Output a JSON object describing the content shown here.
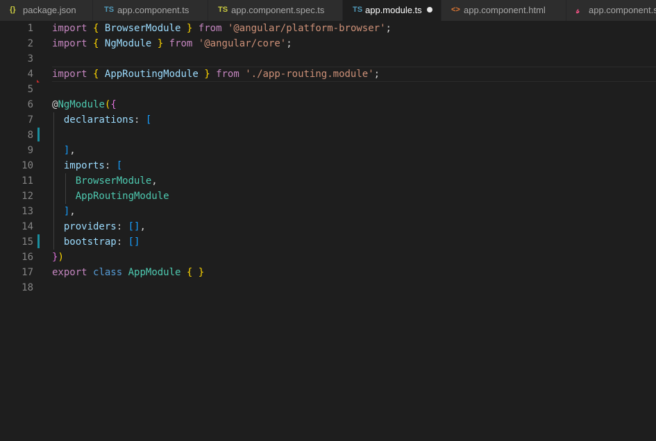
{
  "tabs": [
    {
      "icon": "{}",
      "icon_color": "#cbcb41",
      "label": "package.json",
      "active": false
    },
    {
      "icon": "TS",
      "icon_color": "#519aba",
      "label": "app.component.ts",
      "active": false
    },
    {
      "icon": "TS",
      "icon_color": "#cbcb41",
      "label": "app.component.spec.ts",
      "active": false
    },
    {
      "icon": "TS",
      "icon_color": "#519aba",
      "label": "app.module.ts",
      "active": true,
      "modified": true
    },
    {
      "icon": "<>",
      "icon_color": "#e37933",
      "label": "app.component.html",
      "active": false
    },
    {
      "icon": "scss",
      "icon_color": "#f55385",
      "label": "app.component.s",
      "active": false
    }
  ],
  "colors": {
    "keyword": "#c586c0",
    "class": "#4ec9b0",
    "variable": "#9cdcfe",
    "string": "#ce9178",
    "bracket_1": "#ffd700",
    "bracket_2": "#da70d6",
    "bracket_3": "#179fff"
  },
  "line_numbers": [
    "1",
    "2",
    "3",
    "4",
    "5",
    "6",
    "7",
    "8",
    "9",
    "10",
    "11",
    "12",
    "13",
    "14",
    "15",
    "16",
    "17",
    "18"
  ],
  "code": {
    "l1": {
      "kw": "import",
      "ob": "{",
      "cls": "BrowserModule",
      "cb": "}",
      "from": "from",
      "str": "'@angular/platform-browser'",
      "semi": ";"
    },
    "l2": {
      "kw": "import",
      "ob": "{",
      "cls": "NgModule",
      "cb": "}",
      "from": "from",
      "str": "'@angular/core'",
      "semi": ";"
    },
    "l4": {
      "kw": "import",
      "ob": "{",
      "cls": "AppRoutingModule",
      "cb": "}",
      "from": "from",
      "str": "'./app-routing.module'",
      "semi": ";"
    },
    "l6": {
      "at": "@",
      "cls": "NgModule",
      "p": "(",
      "b": "{"
    },
    "l7": {
      "prop": "declarations",
      "colon": ": ",
      "sb": "["
    },
    "l9": {
      "sb": "]",
      "comma": ","
    },
    "l10": {
      "prop": "imports",
      "colon": ": ",
      "sb": "["
    },
    "l11": {
      "cls": "BrowserModule",
      "comma": ","
    },
    "l12": {
      "cls": "AppRoutingModule"
    },
    "l13": {
      "sb": "]",
      "comma": ","
    },
    "l14": {
      "prop": "providers",
      "colon": ": ",
      "sb": "[]",
      "comma": ","
    },
    "l15": {
      "prop": "bootstrap",
      "colon": ": ",
      "sb": "[]"
    },
    "l16": {
      "b": "}",
      "p": ")"
    },
    "l17": {
      "kw": "export",
      "kw2": "class",
      "cls": "AppModule",
      "ob": "{",
      "cb": "}"
    }
  }
}
